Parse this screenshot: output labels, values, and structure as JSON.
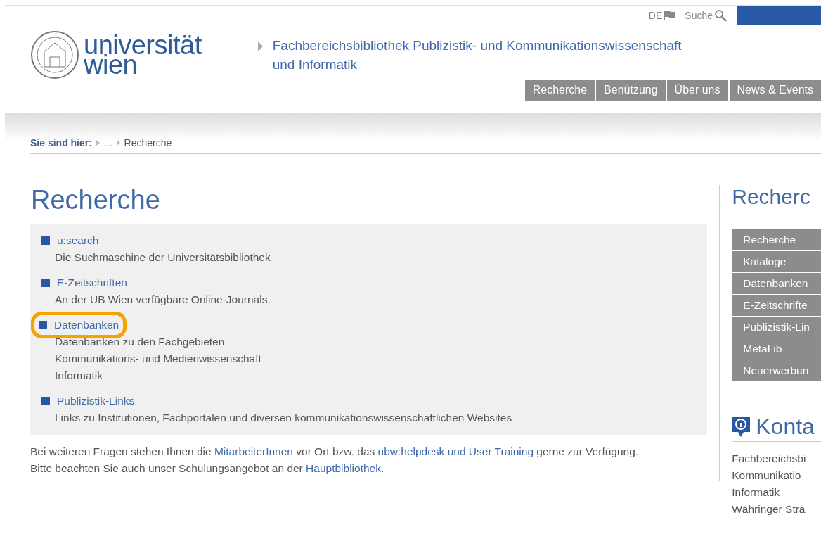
{
  "top_bar": {
    "language": "DE",
    "search": "Suche"
  },
  "header": {
    "logo_line_1": "universität",
    "logo_line_2": "wien",
    "subtitle_line_1": "Fachbereichsbibliothek Publizistik- und Kommunikationswissenschaft",
    "subtitle_line_2": "und Informatik"
  },
  "nav": [
    "Recherche",
    "Benützung",
    "Über uns",
    "News & Events"
  ],
  "breadcrumb": {
    "label": "Sie sind hier:",
    "items": [
      "...",
      "Recherche"
    ]
  },
  "main": {
    "title": "Recherche",
    "entries": [
      {
        "link": "u:search",
        "lines": [
          "Die Suchmaschine der Universitätsbibliothek"
        ],
        "highlighted": false
      },
      {
        "link": "E-Zeitschriften",
        "lines": [
          "An der UB Wien verfügbare Online-Journals."
        ],
        "highlighted": false
      },
      {
        "link": "Datenbanken",
        "lines": [
          "Datenbanken zu den Fachgebieten",
          "Kommunikations- und Medienwissenschaft",
          "Informatik"
        ],
        "highlighted": true
      },
      {
        "link": "Publizistik-Links",
        "lines": [
          "Links zu Institutionen, Fachportalen und diversen kommunikationswissenschaftlichen Websites"
        ],
        "highlighted": false
      }
    ],
    "footer_lines": [
      [
        {
          "text": "Bei weiteren Fragen stehen Ihnen die ",
          "kind": "text"
        },
        {
          "text": "MitarbeiterInnen",
          "kind": "link"
        },
        {
          "text": " vor Ort bzw. das ",
          "kind": "text"
        },
        {
          "text": "ubw:helpdesk und User Training",
          "kind": "link"
        },
        {
          "text": " gerne zur Verfügung.",
          "kind": "text"
        }
      ],
      [
        {
          "text": "Bitte beachten Sie auch unser Schulungsangebot an der ",
          "kind": "text"
        },
        {
          "text": "Hauptbibliothek",
          "kind": "link"
        },
        {
          "text": ".",
          "kind": "text"
        }
      ]
    ]
  },
  "sidebar": {
    "title": "Recherc",
    "menu": [
      "Recherche",
      "Kataloge",
      "Datenbanken",
      "E-Zeitschrifte",
      "Publizistik-Lin",
      "MetaLib",
      "Neuerwerbun"
    ],
    "contact_title": "Konta",
    "contact_lines": [
      "Fachbereichsbi",
      "Kommunikatio",
      "Informatik",
      "Währinger Stra"
    ]
  }
}
